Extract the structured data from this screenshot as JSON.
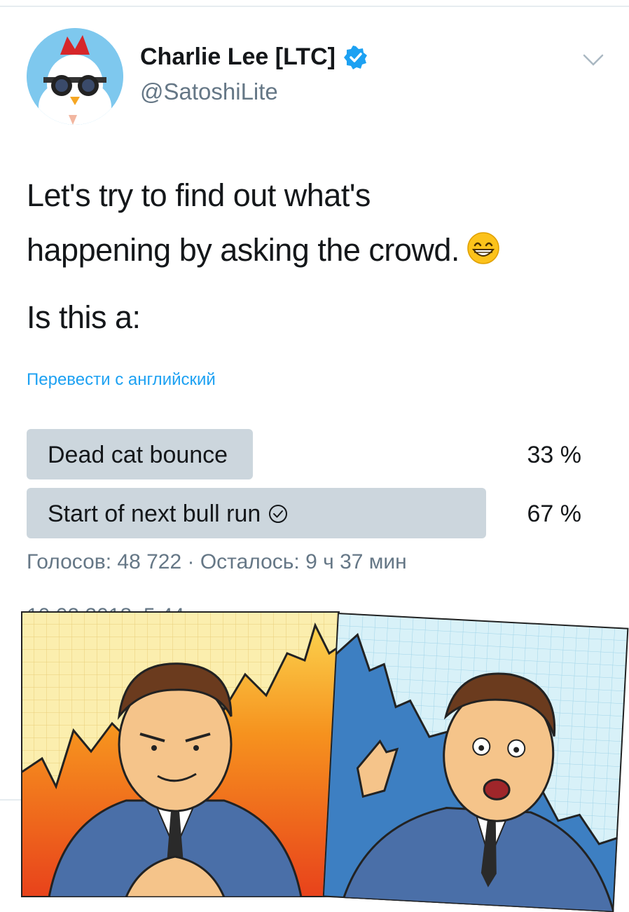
{
  "author": {
    "name": "Charlie Lee [LTC]",
    "handle": "@SatoshiLite",
    "verified": true,
    "avatar_icon": "chicken-avatar-icon"
  },
  "tweet": {
    "lines": [
      "Let's try to find out what's",
      "happening by asking the crowd.",
      "Is this a:"
    ],
    "emoji": "grinning-face-icon",
    "translate_label": "Перевести с английский"
  },
  "poll": {
    "options": [
      {
        "label": "Dead cat bounce",
        "percent_label": "33 %",
        "percent": 33,
        "winner": false
      },
      {
        "label": "Start of next bull run",
        "percent_label": "67 %",
        "percent": 67,
        "winner": true
      }
    ],
    "meta": "Голосов: 48 722 · Осталось: 9 ч 37 мин"
  },
  "timestamp": "10.02.2018, 5:44",
  "colors": {
    "accent": "#1da1f2",
    "poll_bar": "#ccd6dd",
    "secondary_text": "#657786"
  }
}
